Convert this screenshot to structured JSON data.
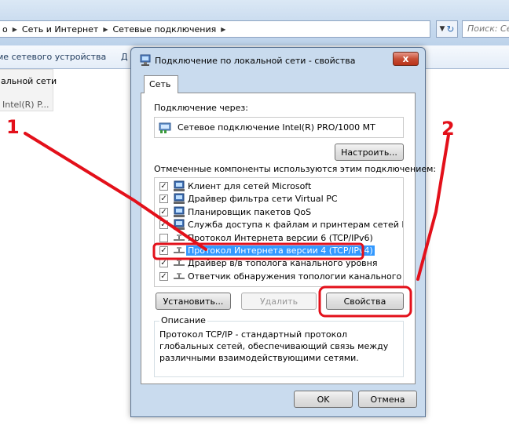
{
  "explorer": {
    "breadcrumbs": [
      "о",
      "Сеть и Интернет",
      "Сетевые подключения"
    ],
    "search_placeholder": "Поиск: Се",
    "toolbar": [
      "ме сетевого устройства",
      "Д"
    ],
    "adapter": {
      "name": "альной сети",
      "device": "Intel(R) P..."
    }
  },
  "dialog": {
    "title": "Подключение по локальной сети - свойства",
    "close_label": "x",
    "tab": "Сеть",
    "connect_via_label": "Подключение через:",
    "adapter_name": "Сетевое подключение Intel(R) PRO/1000 MT",
    "configure_label": "Настроить...",
    "components_label": "Отмеченные компоненты используются этим подключением:",
    "components": [
      {
        "label": "Клиент для сетей Microsoft",
        "checked": true,
        "icon": "network-client-icon"
      },
      {
        "label": "Драйвер фильтра сети Virtual PC",
        "checked": true,
        "icon": "network-service-icon"
      },
      {
        "label": "Планировщик пакетов QoS",
        "checked": true,
        "icon": "network-service-icon"
      },
      {
        "label": "Служба доступа к файлам и принтерам сетей Micro...",
        "checked": true,
        "icon": "network-service-icon"
      },
      {
        "label": "Протокол Интернета версии 6 (TCP/IPv6)",
        "checked": false,
        "icon": "protocol-icon"
      },
      {
        "label": "Протокол Интернета версии 4 (TCP/IPv4)",
        "checked": true,
        "icon": "protocol-icon",
        "selected": true
      },
      {
        "label": "Драйвер в/в тополога канального уровня",
        "checked": true,
        "icon": "protocol-icon"
      },
      {
        "label": "Ответчик обнаружения топологии канального уровня",
        "checked": true,
        "icon": "protocol-icon"
      }
    ],
    "install_label": "Установить...",
    "remove_label": "Удалить",
    "properties_label": "Свойства",
    "description_legend": "Описание",
    "description_text": "Протокол TCP/IP - стандартный протокол глобальных сетей, обеспечивающий связь между различными взаимодействующими сетями.",
    "ok_label": "OK",
    "cancel_label": "Отмена"
  },
  "annotations": {
    "step1": "1",
    "step2": "2",
    "color": "#e3101a"
  }
}
